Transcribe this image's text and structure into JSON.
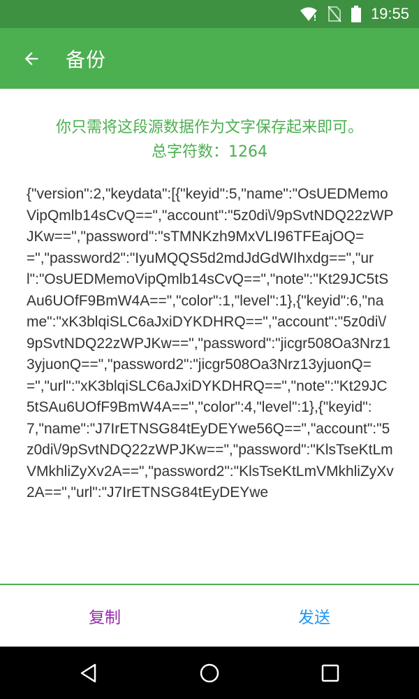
{
  "status_bar": {
    "time": "19:55",
    "icons": [
      "wifi-icon",
      "no-sim-icon",
      "battery-icon"
    ]
  },
  "app_bar": {
    "title": "备份",
    "back_icon": "arrow-back-icon"
  },
  "content": {
    "hint": "你只需将这段源数据作为文字保存起来即可。",
    "count_label": "总字符数：",
    "count_value": "1264",
    "data": "{\"version\":2,\"keydata\":[{\"keyid\":5,\"name\":\"OsUEDMemoVipQmlb14sCvQ==\",\"account\":\"5z0di\\/9pSvtNDQ22zWPJKw==\",\"password\":\"sTMNKzh9MxVLI96TFEajOQ==\",\"password2\":\"IyuMQQS5d2mdJdGdWIhxdg==\",\"url\":\"OsUEDMemoVipQmlb14sCvQ==\",\"note\":\"Kt29JC5tSAu6UOfF9BmW4A==\",\"color\":1,\"level\":1},{\"keyid\":6,\"name\":\"xK3blqiSLC6aJxiDYKDHRQ==\",\"account\":\"5z0di\\/9pSvtNDQ22zWPJKw==\",\"password\":\"jicgr508Oa3Nrz13yjuonQ==\",\"password2\":\"jicgr508Oa3Nrz13yjuonQ==\",\"url\":\"xK3blqiSLC6aJxiDYKDHRQ==\",\"note\":\"Kt29JC5tSAu6UOfF9BmW4A==\",\"color\":4,\"level\":1},{\"keyid\":7,\"name\":\"J7IrETNSG84tEyDEYwe56Q==\",\"account\":\"5z0di\\/9pSvtNDQ22zWPJKw==\",\"password\":\"KlsTseKtLmVMkhliZyXv2A==\",\"password2\":\"KlsTseKtLmVMkhliZyXv2A==\",\"url\":\"J7IrETNSG84tEyDEYwe"
  },
  "bottom_bar": {
    "copy_label": "复制",
    "send_label": "发送"
  },
  "colors": {
    "status_bar": "#3d9140",
    "app_bar": "#4caf50",
    "accent_green": "#4caf50",
    "copy_purple": "#9c27b0",
    "send_blue": "#2196f3"
  }
}
